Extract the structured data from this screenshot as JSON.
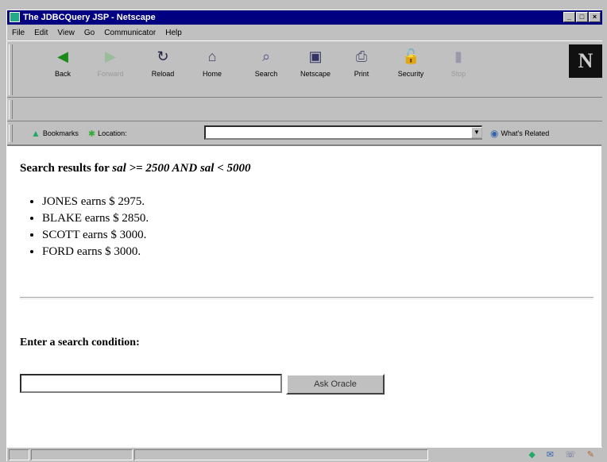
{
  "window": {
    "title": "The JDBCQuery JSP - Netscape",
    "min": "_",
    "max": "□",
    "close": "×"
  },
  "menu": [
    "File",
    "Edit",
    "View",
    "Go",
    "Communicator",
    "Help"
  ],
  "toolbar": {
    "buttons": [
      {
        "label": "Back",
        "icon": "back-arrow-icon"
      },
      {
        "label": "Forward",
        "icon": "forward-arrow-icon"
      },
      {
        "label": "Reload",
        "icon": "reload-icon"
      },
      {
        "label": "Home",
        "icon": "home-icon"
      },
      {
        "label": "Search",
        "icon": "search-icon"
      },
      {
        "label": "Netscape",
        "icon": "netscape-icon"
      },
      {
        "label": "Print",
        "icon": "print-icon"
      },
      {
        "label": "Security",
        "icon": "security-lock-icon"
      },
      {
        "label": "Stop",
        "icon": "stop-icon"
      }
    ],
    "logo": "N"
  },
  "location": {
    "bookmarks": "Bookmarks",
    "location_label": "Location:",
    "url": "",
    "related": "What's Related"
  },
  "page": {
    "heading_prefix": "Search results for ",
    "heading_query": "sal >= 2500 AND sal < 5000",
    "results": [
      "JONES earns $ 2975.",
      "BLAKE earns $ 2850.",
      "SCOTT earns $ 3000.",
      "FORD earns $ 3000."
    ],
    "prompt": "Enter a search condition:",
    "input_value": "",
    "button": "Ask Oracle"
  }
}
